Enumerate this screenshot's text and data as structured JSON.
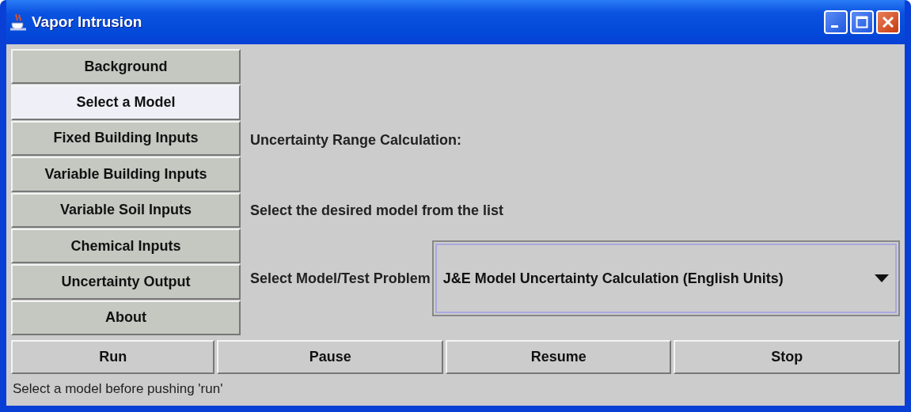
{
  "window": {
    "title": "Vapor Intrusion"
  },
  "sidebar": {
    "items": [
      {
        "label": "Background",
        "selected": false
      },
      {
        "label": "Select a Model",
        "selected": true
      },
      {
        "label": "Fixed Building Inputs",
        "selected": false
      },
      {
        "label": "Variable Building Inputs",
        "selected": false
      },
      {
        "label": "Variable Soil Inputs",
        "selected": false
      },
      {
        "label": "Chemical Inputs",
        "selected": false
      },
      {
        "label": "Uncertainty Output",
        "selected": false
      },
      {
        "label": "About",
        "selected": false
      }
    ]
  },
  "panel": {
    "heading": "Uncertainty Range Calculation:",
    "instruction": "Select the desired model from the list",
    "model_label": "Select Model/Test Problem",
    "model_value": "J&E Model Uncertainty Calculation (English Units)"
  },
  "buttons": [
    "Run",
    "Pause",
    "Resume",
    "Stop"
  ],
  "status_bar": "Select a model before pushing 'run'"
}
